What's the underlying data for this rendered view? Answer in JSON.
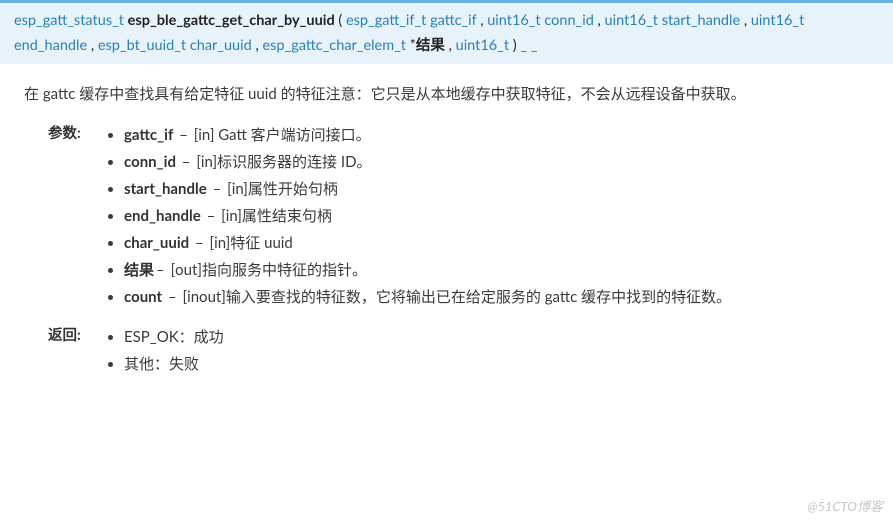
{
  "signature": {
    "return_type": "esp_gatt_status_t",
    "fn_name": "esp_ble_gattc_get_char_by_uuid",
    "params": [
      {
        "type": "esp_gatt_if_t",
        "name": "gattc_if"
      },
      {
        "type": "uint16_t",
        "name": "conn_id"
      },
      {
        "type": "uint16_t",
        "name": "start_handle"
      },
      {
        "type": "uint16_t",
        "name": "end_handle"
      },
      {
        "type": "esp_bt_uuid_t",
        "name": "char_uuid"
      },
      {
        "type": "esp_gattc_char_elem_t",
        "star": "*",
        "name_bold": "结果"
      },
      {
        "type": "uint16_t",
        "trailing": "_ _"
      }
    ]
  },
  "description": "在 gattc 缓存中查找具有给定特征 uuid 的特征注意：它只是从本地缓存中获取特征，不会从远程设备中获取。",
  "labels": {
    "params": "参数:",
    "returns": "返回:"
  },
  "params_list": [
    {
      "name": "gattc_if",
      "sep": " – ",
      "text": "[in] Gatt 客户端访问接口。"
    },
    {
      "name": "conn_id",
      "sep": " – ",
      "text": "[in]标识服务器的连接 ID。"
    },
    {
      "name": "start_handle",
      "sep": " – ",
      "text": "[in]属性开始句柄"
    },
    {
      "name": "end_handle",
      "sep": " – ",
      "text": "[in]属性结束句柄"
    },
    {
      "name": "char_uuid",
      "sep": " – ",
      "text": "[in]特征 uuid"
    },
    {
      "name": "结果",
      "sep": "– ",
      "text": "[out]指向服务中特征的指针。"
    },
    {
      "name": "count",
      "sep": " – ",
      "text": "[inout]输入要查找的特征数，它将输出已在给定服务的 gattc 缓存中找到的特征数。"
    }
  ],
  "returns_list": [
    {
      "text": "ESP_OK：成功"
    },
    {
      "text": "其他：失败"
    }
  ],
  "watermark": "@51CTO博客"
}
